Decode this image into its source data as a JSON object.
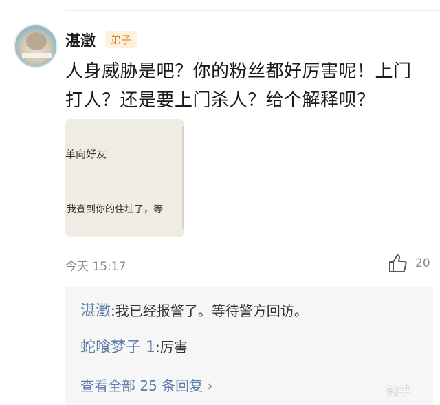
{
  "comment": {
    "username": "湛澂",
    "badge": "弟子",
    "text": "人身威胁是吧？你的粉丝都好厉害呢！上门打人？还是要上门杀人？给个解释呗？",
    "image": {
      "line1": "单向好友",
      "line2": "我查到你的住址了，等"
    },
    "time": "今天 15:17",
    "likes": "20",
    "like_icon": "thumbs-up-icon"
  },
  "replies": [
    {
      "name": "湛澂",
      "text": ":我已经报警了。等待警方回访。"
    },
    {
      "name": "蛇喰梦子 1",
      "text": ":厉害"
    }
  ],
  "view_all": "查看全部 25 条回复 ›",
  "watermark": "知乎"
}
